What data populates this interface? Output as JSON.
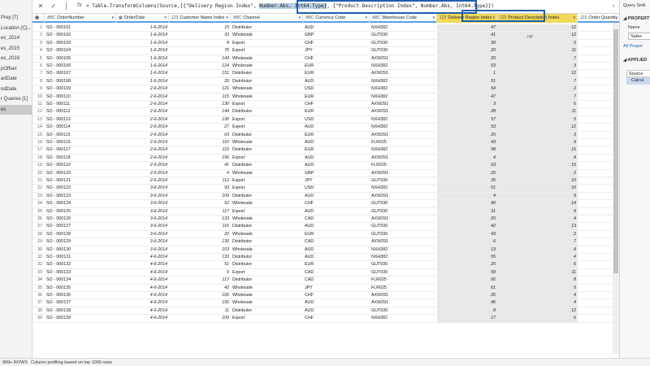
{
  "left_pane": {
    "queries": [
      {
        "label": "Prep [7]",
        "italic": false,
        "selected": false
      },
      {
        "label": "Location (C)...",
        "italic": true,
        "selected": false
      },
      {
        "label": "es_2014",
        "italic": true,
        "selected": false
      },
      {
        "label": "es_2015",
        "italic": true,
        "selected": false
      },
      {
        "label": "es_2016",
        "italic": true,
        "selected": false
      },
      {
        "label": "pOffset",
        "italic": false,
        "selected": false
      },
      {
        "label": "artDate",
        "italic": false,
        "selected": false
      },
      {
        "label": "ndDate",
        "italic": false,
        "selected": false
      },
      {
        "label": "r Queries [1]",
        "italic": false,
        "selected": false
      },
      {
        "label": "es",
        "italic": false,
        "selected": true
      }
    ]
  },
  "formula_bar": {
    "cancel_glyph": "✕",
    "commit_glyph": "✓",
    "fx_label": "fx",
    "formula_pre": "= Table.TransformColumns(Source,{{\"Delivery Region Index\", ",
    "formula_highlight": "Number.Abs, Int64.Type}",
    "formula_mid": ", ",
    "formula_post": "{\"Product Description Index\", Number.Abs, Int64.Type}})",
    "expand_glyph": "⌄"
  },
  "grid": {
    "columns": [
      {
        "key": "OrderNumber",
        "label": "OrderNumber",
        "type": "ABC"
      },
      {
        "key": "OrderDate",
        "label": "OrderDate",
        "type": "▦"
      },
      {
        "key": "CustomerNameIndex",
        "label": "Customer Name Index",
        "type": "123"
      },
      {
        "key": "Channel",
        "label": "Channel",
        "type": "ABC"
      },
      {
        "key": "CurrencyCode",
        "label": "Currency Code",
        "type": "ABC"
      },
      {
        "key": "WarehouseCode",
        "label": "Warehouse Code",
        "type": "ABC"
      },
      {
        "key": "DeliveryRegionIndex",
        "label": "Delivery Region Index",
        "type": "123"
      },
      {
        "key": "ProductDescriptionIndex",
        "label": "Product Description Index",
        "type": "123"
      },
      {
        "key": "OrderQuantity",
        "label": "Order Quantity",
        "type": "123"
      }
    ],
    "product_blank_note": "HP",
    "rows": [
      [
        "1",
        "SO - 000101",
        "1-6-2014",
        "15",
        "Distributor",
        "AUD",
        "NXH382",
        "47",
        "12"
      ],
      [
        "2",
        "SO - 000102",
        "1-6-2014",
        "33",
        "Wholesale",
        "GBP",
        "GUT930",
        "41",
        "12"
      ],
      [
        "3",
        "SO - 000103",
        "1-6-2014",
        "8",
        "Export",
        "CHF",
        "GUT930",
        "39",
        "5"
      ],
      [
        "4",
        "SO - 000104",
        "1-6-2014",
        "76",
        "Export",
        "JPY",
        "GUT930",
        "20",
        "11"
      ],
      [
        "5",
        "SO - 000105",
        "1-6-2014",
        "143",
        "Wholesale",
        "CHF",
        "AXW291",
        "20",
        "7"
      ],
      [
        "6",
        "SO - 000106",
        "1-6-2014",
        "124",
        "Wholesale",
        "EUR",
        "NXH382",
        "53",
        "3"
      ],
      [
        "7",
        "SO - 000107",
        "1-6-2014",
        "151",
        "Distributor",
        "EUR",
        "AXW291",
        "1",
        "12"
      ],
      [
        "8",
        "SO - 000108",
        "1-6-2014",
        "20",
        "Distributor",
        "AUD",
        "NXH382",
        "51",
        "7"
      ],
      [
        "9",
        "SO - 000109",
        "2-6-2014",
        "121",
        "Wholesale",
        "USD",
        "NXH382",
        "54",
        "2"
      ],
      [
        "10",
        "SO - 000110",
        "2-6-2014",
        "115",
        "Wholesale",
        "EUR",
        "NXH382",
        "47",
        "7"
      ],
      [
        "11",
        "SO - 000111",
        "2-6-2014",
        "130",
        "Export",
        "CHF",
        "AXW291",
        "3",
        "6"
      ],
      [
        "12",
        "SO - 000112",
        "2-6-2014",
        "144",
        "Distributor",
        "EUR",
        "AXW291",
        "28",
        "11"
      ],
      [
        "13",
        "SO - 000113",
        "2-6-2014",
        "130",
        "Export",
        "USD",
        "NXH382",
        "57",
        "5"
      ],
      [
        "14",
        "SO - 000114",
        "2-6-2014",
        "27",
        "Export",
        "AUD",
        "NXH382",
        "53",
        "12"
      ],
      [
        "15",
        "SO - 000115",
        "2-6-2014",
        "63",
        "Distributor",
        "EUR",
        "AXW291",
        "25",
        "3"
      ],
      [
        "16",
        "SO - 000116",
        "2-6-2014",
        "110",
        "Wholesale",
        "AUD",
        "FLR025",
        "43",
        "9"
      ],
      [
        "17",
        "SO - 000117",
        "2-6-2014",
        "115",
        "Distributor",
        "EUR",
        "NXH382",
        "58",
        "15"
      ],
      [
        "18",
        "SO - 000118",
        "2-6-2014",
        "156",
        "Export",
        "AUD",
        "AXW291",
        "4",
        "4"
      ],
      [
        "19",
        "SO - 000119",
        "2-6-2014",
        "41",
        "Distributor",
        "AUD",
        "FLR025",
        "63",
        "15"
      ],
      [
        "20",
        "SO - 000120",
        "2-6-2014",
        "4",
        "Wholesale",
        "GBP",
        "AXW291",
        "25",
        "2"
      ],
      [
        "21",
        "SO - 000121",
        "2-6-2014",
        "112",
        "Export",
        "JPY",
        "GUT930",
        "35",
        "10"
      ],
      [
        "22",
        "SO - 000122",
        "3-6-2014",
        "93",
        "Export",
        "USD",
        "NXH382",
        "51",
        "10"
      ],
      [
        "23",
        "SO - 000123",
        "3-6-2014",
        "109",
        "Distributor",
        "AUD",
        "AXW291",
        "4",
        "9"
      ],
      [
        "24",
        "SO - 000124",
        "3-6-2014",
        "52",
        "Wholesale",
        "CHF",
        "GUT930",
        "40",
        "14"
      ],
      [
        "25",
        "SO - 000125",
        "3-6-2014",
        "117",
        "Export",
        "AUD",
        "GUT930",
        "31",
        "9"
      ],
      [
        "26",
        "SO - 000126",
        "3-6-2014",
        "133",
        "Wholesale",
        "CAD",
        "AXW291",
        "20",
        "4"
      ],
      [
        "27",
        "SO - 000127",
        "3-6-2014",
        "116",
        "Distributor",
        "AUD",
        "GUT930",
        "42",
        "13"
      ],
      [
        "28",
        "SO - 000128",
        "3-6-2014",
        "20",
        "Wholesale",
        "EUR",
        "GUT930",
        "43",
        "2"
      ],
      [
        "29",
        "SO - 000129",
        "3-6-2014",
        "130",
        "Distributor",
        "CAD",
        "AXW291",
        "6",
        "7"
      ],
      [
        "30",
        "SO - 000130",
        "3-6-2014",
        "103",
        "Wholesale",
        "AUD",
        "NXH382",
        "13",
        "4"
      ],
      [
        "31",
        "SO - 000131",
        "4-6-2014",
        "133",
        "Distributor",
        "AUD",
        "NXH382",
        "55",
        "4"
      ],
      [
        "32",
        "SO - 000132",
        "4-6-2014",
        "51",
        "Distributor",
        "EUR",
        "GUT930",
        "25",
        "6"
      ],
      [
        "33",
        "SO - 000133",
        "4-6-2014",
        "9",
        "Export",
        "CAD",
        "GUT930",
        "59",
        "11"
      ],
      [
        "34",
        "SO - 000134",
        "4-6-2014",
        "117",
        "Distributor",
        "CAD",
        "FLR025",
        "66",
        "8"
      ],
      [
        "35",
        "SO - 000135",
        "4-6-2014",
        "42",
        "Wholesale",
        "JPY",
        "FLR025",
        "61",
        "5"
      ],
      [
        "36",
        "SO - 000136",
        "4-6-2014",
        "166",
        "Wholesale",
        "CHF",
        "AXW291",
        "26",
        "4"
      ],
      [
        "37",
        "SO - 000137",
        "4-6-2014",
        "155",
        "Wholesale",
        "AUD",
        "AXW291",
        "46",
        "4"
      ],
      [
        "38",
        "SO - 000138",
        "4-6-2014",
        "11",
        "Distributor",
        "AUD",
        "GUT930",
        "8",
        "12"
      ],
      [
        "39",
        "SO - 000139",
        "4-6-2014",
        "109",
        "Export",
        "CHF",
        "NXH382",
        "17",
        "6"
      ]
    ]
  },
  "right_pane": {
    "title": "Query Setti",
    "properties_heading": "◢ PROPERT",
    "name_label": "Name",
    "name_value": "Sales",
    "all_properties_link": "All Proper",
    "applied_steps_heading": "◢ APPLIED",
    "step1": "Source",
    "step2": "Calcul"
  },
  "status_bar": {
    "rows_text": "999+ ROWS",
    "profiling_text": "Column profiling based on top 1000 rows"
  }
}
